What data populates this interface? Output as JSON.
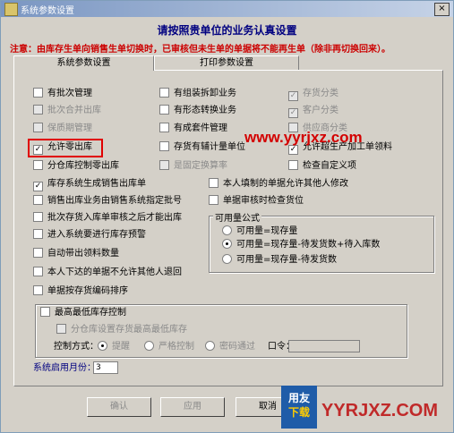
{
  "window": {
    "title": "系统参数设置",
    "close_glyph": "×"
  },
  "header": "请按照贵单位的业务认真设置",
  "notice": "注意：由库存生单向销售生单切换时，已审核但未生单的单据将不能再生单（除非再切换回来）。",
  "tabs": [
    {
      "label": "系统参数设置"
    },
    {
      "label": "打印参数设置"
    }
  ],
  "options": {
    "col1": [
      {
        "label": "有批次管理",
        "checked": false,
        "disabled": false
      },
      {
        "label": "批次合并出库",
        "checked": false,
        "disabled": true
      },
      {
        "label": "保质期管理",
        "checked": false,
        "disabled": true
      },
      {
        "label": "允许零出库",
        "checked": true,
        "disabled": false
      },
      {
        "label": "分仓库控制零出库",
        "checked": false,
        "disabled": false
      },
      {
        "label": "库存系统生成销售出库单",
        "checked": true,
        "disabled": false
      },
      {
        "label": "销售出库业务由销售系统指定批号",
        "checked": false,
        "disabled": false
      },
      {
        "label": "批次存货入库单审核之后才能出库",
        "checked": false,
        "disabled": false
      },
      {
        "label": "进入系统要进行库存预警",
        "checked": false,
        "disabled": false
      },
      {
        "label": "自动带出领料数量",
        "checked": false,
        "disabled": false
      },
      {
        "label": "本人下达的单据不允许其他人退回",
        "checked": false,
        "disabled": false
      },
      {
        "label": "单据按存货编码排序",
        "checked": false,
        "disabled": false
      }
    ],
    "col2": [
      {
        "label": "有组装拆卸业务",
        "checked": false,
        "disabled": false
      },
      {
        "label": "有形态转换业务",
        "checked": false,
        "disabled": false
      },
      {
        "label": "有成套件管理",
        "checked": false,
        "disabled": false
      },
      {
        "label": "存货有辅计量单位",
        "checked": false,
        "disabled": false
      },
      {
        "label": "是固定换算率",
        "checked": false,
        "disabled": true
      },
      {
        "label": "本人填制的单据允许其他人修改",
        "checked": false,
        "disabled": false
      },
      {
        "label": "单据审核时检查货位",
        "checked": false,
        "disabled": false
      }
    ],
    "col3": [
      {
        "label": "存货分类",
        "checked": true,
        "disabled": true
      },
      {
        "label": "客户分类",
        "checked": true,
        "disabled": true
      },
      {
        "label": "供应商分类",
        "checked": false,
        "disabled": true
      },
      {
        "label": "允许超生产加工单领料",
        "checked": true,
        "disabled": false
      },
      {
        "label": "检查自定义项",
        "checked": false,
        "disabled": false
      }
    ]
  },
  "available_qty": {
    "title": "可用量公式",
    "options": [
      {
        "label": "可用量=现存量",
        "selected": false
      },
      {
        "label": "可用量=现存量-待发货数+待入库数",
        "selected": true
      },
      {
        "label": "可用量=现存量-待发货数",
        "selected": false
      }
    ]
  },
  "max_stock": {
    "label": "最高最低库存控制",
    "checked": false,
    "sub_label": "分仓库设置存货最高最低库存",
    "control_label": "控制方式：",
    "modes": [
      {
        "label": "提醒"
      },
      {
        "label": "严格控制"
      },
      {
        "label": "密码通过"
      }
    ],
    "password_label": "口令：",
    "password_value": ""
  },
  "start_month": {
    "label": "系统启用月份：",
    "value": "3"
  },
  "buttons": {
    "confirm": "确认",
    "apply": "应用",
    "cancel": "取消"
  },
  "watermark": "www.yyrjxz.com",
  "logo": {
    "line1": "用友",
    "line2": "下载"
  },
  "brand": "YYRJXZ.COM",
  "check_glyph": "✓",
  "colors": {
    "accent": "#000080",
    "notice": "#cc0000",
    "highlight": "#e00000"
  }
}
